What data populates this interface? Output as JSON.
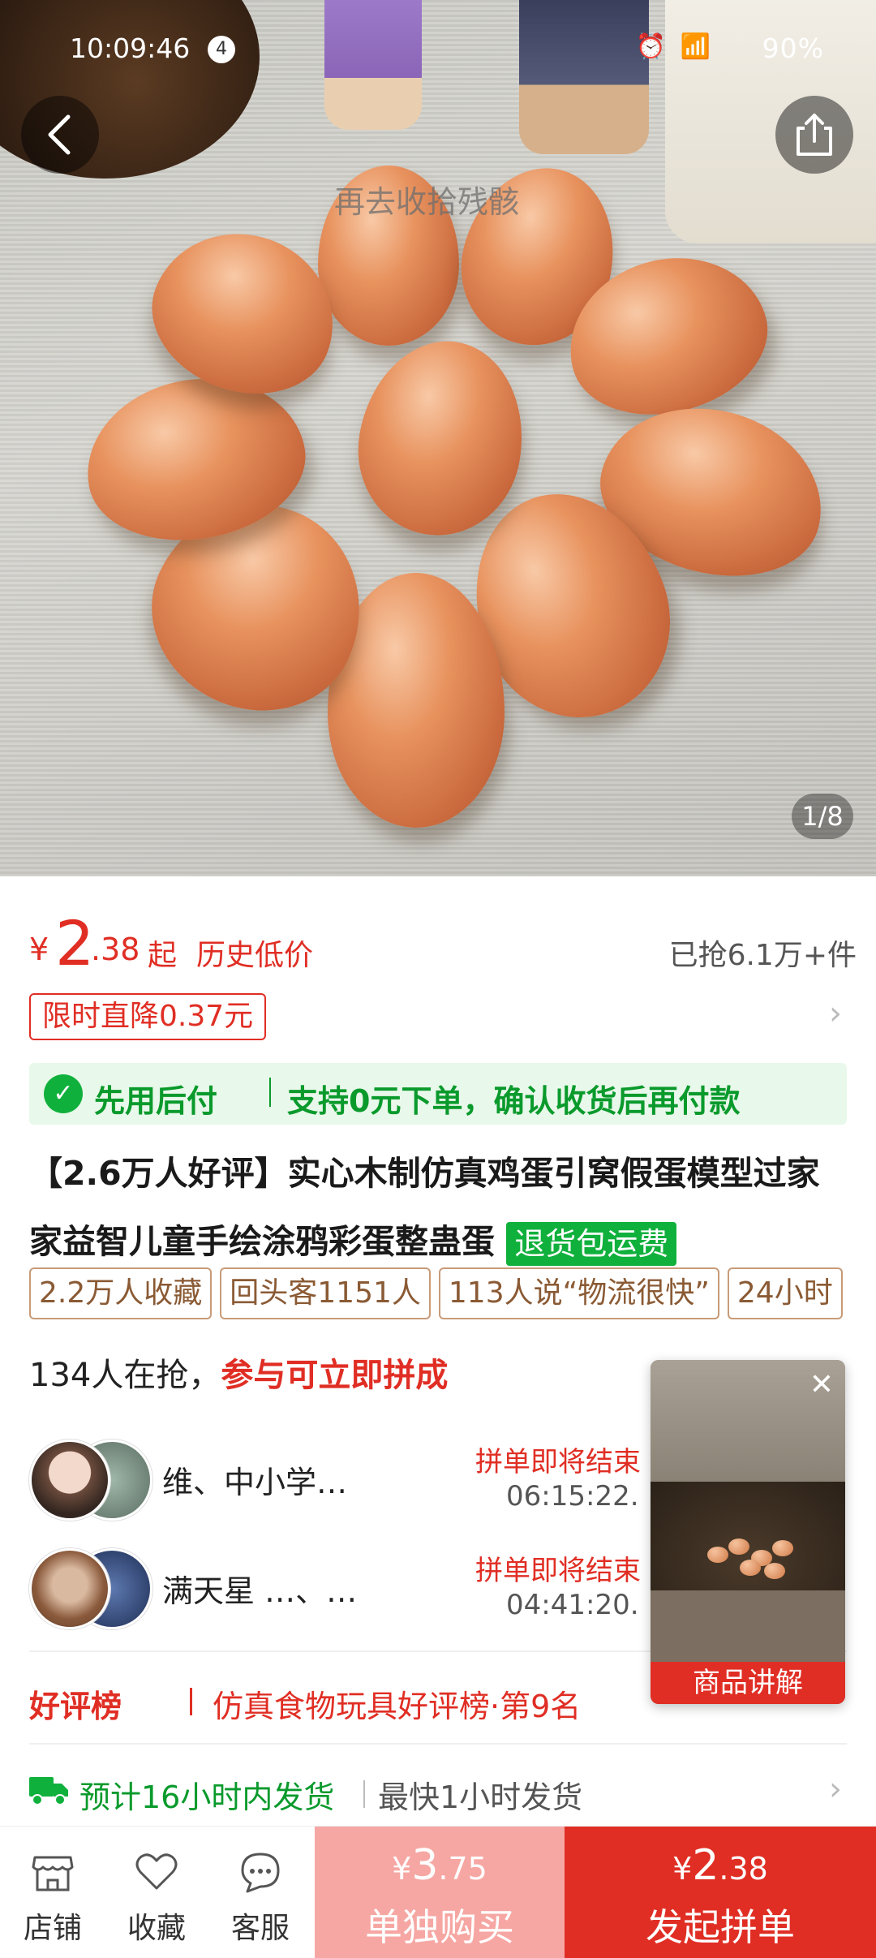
{
  "status_bar": {
    "time": "10:09:46",
    "notification_count": "4",
    "battery": "90%"
  },
  "hero": {
    "watermark": "再去收拾残骸",
    "counter": "1/8"
  },
  "price": {
    "currency": "¥",
    "integer": "2",
    "decimal": ".38",
    "suffix": "起",
    "history_label": "历史低价",
    "sold": "已抢6.1万+件"
  },
  "flash_sale": "限时直降0.37元",
  "pay_later": {
    "label": "先用后付",
    "desc": "支持0元下单，确认收货后再付款"
  },
  "product": {
    "title": "【2.6万人好评】实心木制仿真鸡蛋引窝假蛋模型过家家益智儿童手绘涂鸦彩蛋整蛊蛋",
    "return_badge": "退货包运费"
  },
  "tags": [
    "2.2万人收藏",
    "回头客1151人",
    "113人说“物流很快”",
    "24小时"
  ],
  "group_buy": {
    "count_text": "134人在抢，",
    "cta_text": "参与可立即拼成",
    "groups": [
      {
        "name": "维、中小学…",
        "status": "拼单即将结束",
        "timer": "06:15:22."
      },
      {
        "name": "满天星 …、…",
        "status": "拼单即将结束",
        "timer": "04:41:20."
      }
    ]
  },
  "ranking": {
    "label": "好评榜",
    "text": "仿真食物玩具好评榜·第9名"
  },
  "shipping": {
    "estimate": "预计16小时内发货",
    "fastest": "最快1小时发货"
  },
  "video_popup": {
    "caption": "商品讲解"
  },
  "bottom_bar": {
    "nav": [
      {
        "label": "店铺",
        "icon": "store-icon"
      },
      {
        "label": "收藏",
        "icon": "heart-icon"
      },
      {
        "label": "客服",
        "icon": "chat-icon"
      }
    ],
    "solo": {
      "currency": "¥",
      "integer": "3",
      "decimal": ".75",
      "label": "单独购买"
    },
    "group": {
      "currency": "¥",
      "integer": "2",
      "decimal": ".38",
      "label": "发起拼单"
    }
  },
  "colors": {
    "accent_red": "#e02e24",
    "green": "#10b03c",
    "light_red": "#f6a7a3"
  }
}
